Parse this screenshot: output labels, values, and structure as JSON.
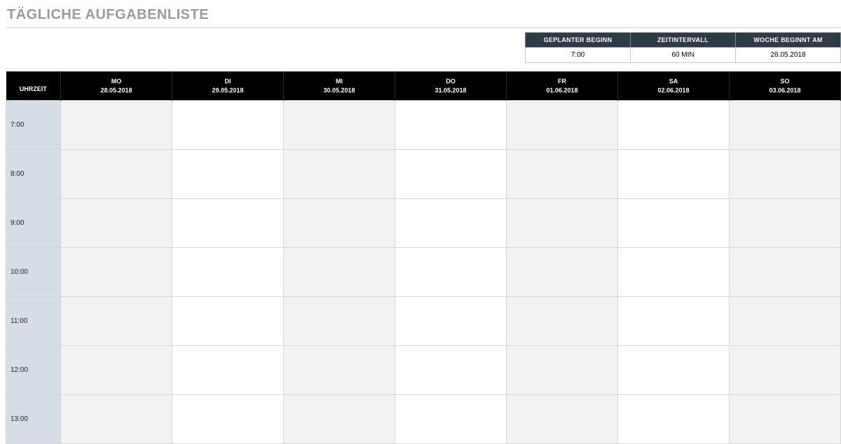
{
  "title": "TÄGLICHE AUFGABENLISTE",
  "settings": {
    "headers": {
      "planned_start": "GEPLANTER BEGINN",
      "time_interval": "ZEITINTERVALL",
      "week_starts": "WOCHE BEGINNT AM"
    },
    "values": {
      "planned_start": "7:00",
      "time_interval": "60 MIN",
      "week_starts": "28.05.2018"
    }
  },
  "schedule": {
    "time_header": "UHRZEIT",
    "days": [
      {
        "abbr": "MO",
        "date": "28.05.2018"
      },
      {
        "abbr": "DI",
        "date": "29.05.2018"
      },
      {
        "abbr": "MI",
        "date": "30.05.2018"
      },
      {
        "abbr": "DO",
        "date": "31.05.2018"
      },
      {
        "abbr": "FR",
        "date": "01.06.2018"
      },
      {
        "abbr": "SA",
        "date": "02.06.2018"
      },
      {
        "abbr": "SO",
        "date": "03.06.2018"
      }
    ],
    "times": [
      "7:00",
      "8:00",
      "9:00",
      "10:00",
      "11:00",
      "12:00",
      "13:00"
    ]
  }
}
